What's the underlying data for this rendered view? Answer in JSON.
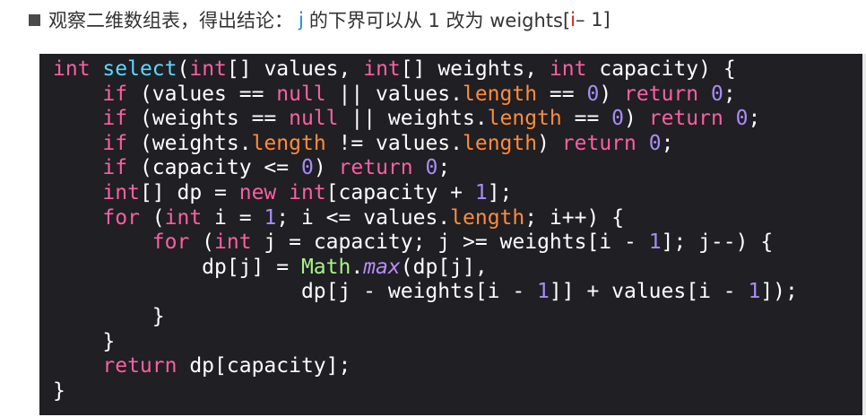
{
  "note": {
    "prefix": "观察二维数组表，得出结论：",
    "j_var": "j",
    "middle": "的下界可以从 1 改为 weights[",
    "i_var": "i",
    "suffix": " – 1]"
  },
  "code": {
    "language": "java",
    "lines": [
      [
        [
          "kw",
          "int"
        ],
        [
          "p",
          " "
        ],
        [
          "fn",
          "select"
        ],
        [
          "p",
          "("
        ],
        [
          "kw",
          "int"
        ],
        [
          "p",
          "[] values, "
        ],
        [
          "kw",
          "int"
        ],
        [
          "p",
          "[] weights, "
        ],
        [
          "kw",
          "int"
        ],
        [
          "p",
          " capacity) {"
        ]
      ],
      [
        [
          "p",
          "    "
        ],
        [
          "kw",
          "if"
        ],
        [
          "p",
          " (values == "
        ],
        [
          "kw",
          "null"
        ],
        [
          "p",
          " || values."
        ],
        [
          "prop",
          "length"
        ],
        [
          "p",
          " == "
        ],
        [
          "num",
          "0"
        ],
        [
          "p",
          ") "
        ],
        [
          "kw",
          "return"
        ],
        [
          "p",
          " "
        ],
        [
          "num",
          "0"
        ],
        [
          "p",
          ";"
        ]
      ],
      [
        [
          "p",
          "    "
        ],
        [
          "kw",
          "if"
        ],
        [
          "p",
          " (weights == "
        ],
        [
          "kw",
          "null"
        ],
        [
          "p",
          " || weights."
        ],
        [
          "prop",
          "length"
        ],
        [
          "p",
          " == "
        ],
        [
          "num",
          "0"
        ],
        [
          "p",
          ") "
        ],
        [
          "kw",
          "return"
        ],
        [
          "p",
          " "
        ],
        [
          "num",
          "0"
        ],
        [
          "p",
          ";"
        ]
      ],
      [
        [
          "p",
          "    "
        ],
        [
          "kw",
          "if"
        ],
        [
          "p",
          " (weights."
        ],
        [
          "prop",
          "length"
        ],
        [
          "p",
          " != values."
        ],
        [
          "prop",
          "length"
        ],
        [
          "p",
          ") "
        ],
        [
          "kw",
          "return"
        ],
        [
          "p",
          " "
        ],
        [
          "num",
          "0"
        ],
        [
          "p",
          ";"
        ]
      ],
      [
        [
          "p",
          "    "
        ],
        [
          "kw",
          "if"
        ],
        [
          "p",
          " (capacity <= "
        ],
        [
          "num",
          "0"
        ],
        [
          "p",
          ") "
        ],
        [
          "kw",
          "return"
        ],
        [
          "p",
          " "
        ],
        [
          "num",
          "0"
        ],
        [
          "p",
          ";"
        ]
      ],
      [
        [
          "p",
          "    "
        ],
        [
          "kw",
          "int"
        ],
        [
          "p",
          "[] dp = "
        ],
        [
          "kw",
          "new"
        ],
        [
          "p",
          " "
        ],
        [
          "kw",
          "int"
        ],
        [
          "p",
          "[capacity + "
        ],
        [
          "num",
          "1"
        ],
        [
          "p",
          "];"
        ]
      ],
      [
        [
          "p",
          "    "
        ],
        [
          "kw",
          "for"
        ],
        [
          "p",
          " ("
        ],
        [
          "kw",
          "int"
        ],
        [
          "p",
          " i = "
        ],
        [
          "num",
          "1"
        ],
        [
          "p",
          "; i <= values."
        ],
        [
          "prop",
          "length"
        ],
        [
          "p",
          "; i++) {"
        ]
      ],
      [
        [
          "p",
          "        "
        ],
        [
          "kw",
          "for"
        ],
        [
          "p",
          " ("
        ],
        [
          "kw",
          "int"
        ],
        [
          "p",
          " j = capacity; j >= weights[i - "
        ],
        [
          "num",
          "1"
        ],
        [
          "p",
          "]; j--) {"
        ]
      ],
      [
        [
          "p",
          "            dp[j] = "
        ],
        [
          "cls",
          "Math"
        ],
        [
          "p",
          "."
        ],
        [
          "mth",
          "max"
        ],
        [
          "p",
          "(dp[j],"
        ]
      ],
      [
        [
          "p",
          "                    dp[j - weights[i - "
        ],
        [
          "num",
          "1"
        ],
        [
          "p",
          "]] + values[i - "
        ],
        [
          "num",
          "1"
        ],
        [
          "p",
          "]);"
        ]
      ],
      [
        [
          "p",
          "        }"
        ]
      ],
      [
        [
          "p",
          "    }"
        ]
      ],
      [
        [
          "p",
          "    "
        ],
        [
          "kw",
          "return"
        ],
        [
          "p",
          " dp[capacity];"
        ]
      ],
      [
        [
          "p",
          "}"
        ]
      ]
    ]
  },
  "colors": {
    "code_background": "#1f1f24",
    "keyword": "#fc5fa3",
    "function_name": "#5dd8ff",
    "number": "#a98cf5",
    "property": "#ff8c3a",
    "class_name": "#a9f28a",
    "method": "#bb8cf7",
    "highlight_j": "#1a8fe0",
    "highlight_i": "#e02020"
  }
}
